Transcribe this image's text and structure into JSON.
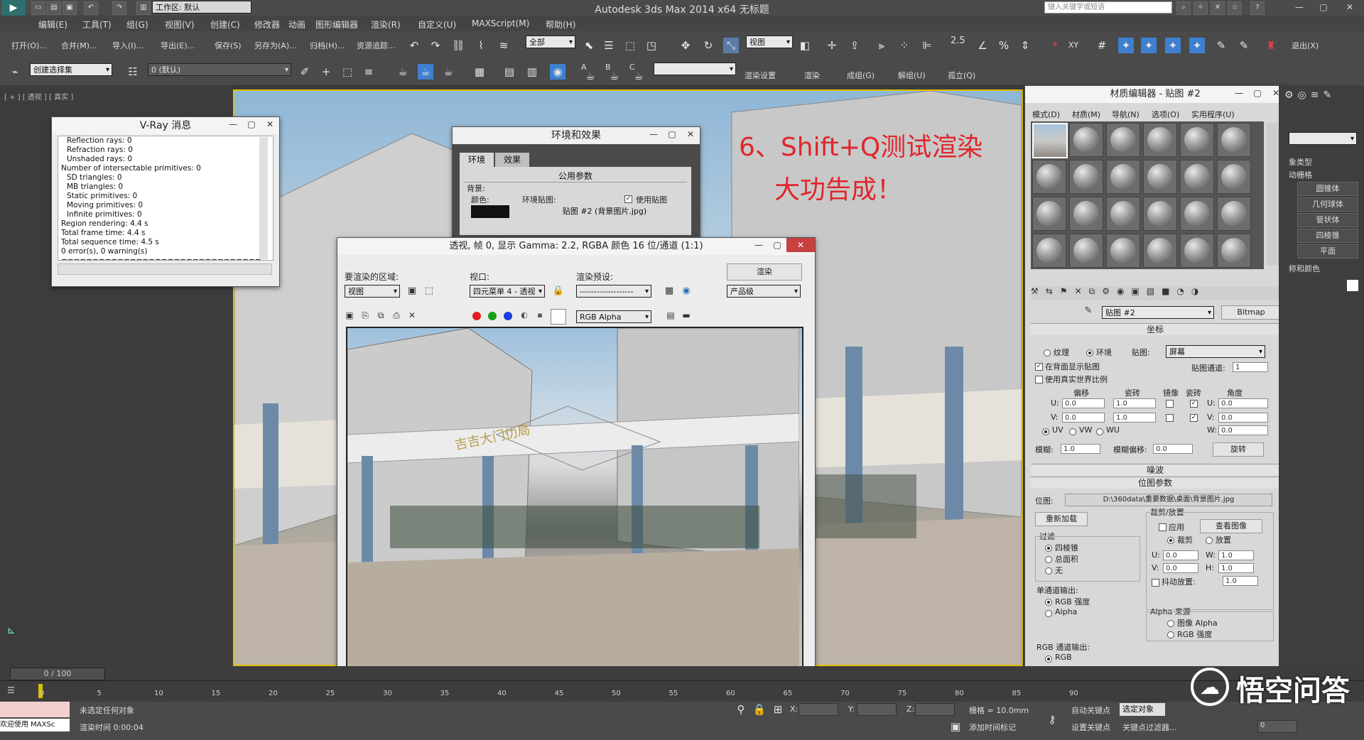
{
  "app": {
    "title": "Autodesk 3ds Max  2014 x64      无标题",
    "workspace": "工作区: 默认",
    "search_placeholder": "键入关键字或短语",
    "min": "—",
    "max": "▢",
    "close": "✕"
  },
  "menu": [
    "编辑(E)",
    "工具(T)",
    "组(G)",
    "视图(V)",
    "创建(C)",
    "修改器",
    "动画",
    "图形编辑器",
    "渲染(R)",
    "自定义(U)",
    "MAXScript(M)",
    "帮助(H)"
  ],
  "toolbar1": {
    "items": [
      "打开(O)...",
      "合并(M)...",
      "导入(I)...",
      "导出(E)...",
      "保存(S)",
      "另存为(A)...",
      "归档(H)...",
      "资源追踪..."
    ],
    "select_filter": "全部",
    "ref_coord": "视图",
    "snap_label": "2.5",
    "exit": "退出(X)"
  },
  "toolbar2": {
    "selection_set": "创建选择集",
    "layer": "0 (默认)",
    "render_setup": "渲染设置",
    "render": "渲染",
    "b1": "成组(G)",
    "b2": "解组(U)",
    "b3": "孤立(Q)",
    "letters": [
      "A",
      "B",
      "C"
    ]
  },
  "viewport": {
    "label": "[ + ] [ 透视 ] [ 真实 ]",
    "annotation1": "6、Shift+Q测试渲染",
    "annotation2": "大功告成！",
    "sign_text": "吉吉大门仂局",
    "colors": {
      "annotation": "#e0262b",
      "border": "#e0c200"
    }
  },
  "vray": {
    "title": "V-Ray 消息",
    "lines": [
      "Reflection rays: 0",
      "Refraction rays: 0",
      "Unshaded rays: 0",
      "Number of intersectable primitives: 0",
      "SD triangles: 0",
      "MB triangles: 0",
      "Static primitives: 0",
      "Moving primitives: 0",
      "Infinite primitives: 0",
      "Region rendering: 4.4 s",
      "Total frame time: 4.4 s",
      "Total sequence time: 4.5 s",
      "0 error(s), 0 warning(s)",
      "================================"
    ]
  },
  "env": {
    "title": "环境和效果",
    "tab1": "环境",
    "tab2": "效果",
    "section": "公用参数",
    "bg_label": "背景:",
    "color_label": "颜色:",
    "map_label": "环境贴图:",
    "use_map": "使用贴图",
    "map_name": "贴图 #2 (背景图片.jpg)"
  },
  "render_frame": {
    "title": "透视, 帧 0, 显示 Gamma: 2.2, RGBA 颜色 16 位/通道 (1:1)",
    "area_label": "要渲染的区域:",
    "area_value": "视图",
    "viewport_label": "视口:",
    "viewport_value": "四元菜单 4 - 透视",
    "preset_label": "渲染预设:",
    "preset_value": "-------------------",
    "render_btn": "渲染",
    "quality": "产品级",
    "channel": "RGB Alpha",
    "sign_text": "吉吉大门仂局"
  },
  "mat": {
    "title": "材质编辑器 - 贴图 #2",
    "menus": [
      "模式(D)",
      "材质(M)",
      "导航(N)",
      "选项(O)",
      "实用程序(U)"
    ],
    "map_name": "贴图 #2",
    "map_type": "Bitmap",
    "coord_section": "坐标",
    "texture": "纹理",
    "environ": "环境",
    "map_label": "贴图:",
    "map_value": "屏幕",
    "show_back": "在背面显示贴图",
    "real_world": "使用真实世界比例",
    "channel_label": "贴图通道:",
    "channel_value": "1",
    "col_offset": "偏移",
    "col_tiling": "瓷砖",
    "col_mirror": "镜像",
    "col_tile": "瓷砖",
    "col_angle": "角度",
    "u": "U:",
    "v": "V:",
    "w": "W:",
    "u_offset": "0.0",
    "v_offset": "0.0",
    "u_tiling": "1.0",
    "v_tiling": "1.0",
    "u_angle": "0.0",
    "v_angle": "0.0",
    "w_angle": "0.0",
    "uv": "UV",
    "vw": "VW",
    "wu": "WU",
    "blur_label": "模糊:",
    "blur_value": "1.0",
    "blur_offset_label": "模糊偏移:",
    "blur_offset_value": "0.0",
    "rotate": "旋转",
    "noise_section": "噪波",
    "bitmap_section": "位图参数",
    "bitmap_label": "位图:",
    "bitmap_path": "D:\\360data\\重要数据\\桌面\\背景图片.jpg",
    "reload": "重新加载",
    "crop_section": "裁剪/放置",
    "apply": "应用",
    "view_image": "查看图像",
    "crop": "裁剪",
    "place": "放置",
    "filter_section": "过滤",
    "f1": "四棱锥",
    "f2": "总面积",
    "f3": "无",
    "cu": "U:",
    "cv": "V:",
    "cw": "W:",
    "ch": "H:",
    "cu_val": "0.0",
    "cv_val": "0.0",
    "cw_val": "1.0",
    "ch_val": "1.0",
    "jitter": "抖动放置:",
    "jitter_val": "1.0",
    "mono_section": "单通道输出:",
    "mono1": "RGB 强度",
    "mono2": "Alpha",
    "alpha_section": "Alpha 来源",
    "alpha1": "图像 Alpha",
    "alpha2": "RGB 强度",
    "rgb_section": "RGB 通道输出:",
    "rgb1": "RGB"
  },
  "cmdpanel": [
    "象类型",
    "动栅格",
    "圆锥体",
    "几何球体",
    "管状体",
    "四棱锥",
    "平面",
    "称和颜色"
  ],
  "timeline": {
    "frame": "0 / 100",
    "ticks": [
      "0",
      "5",
      "10",
      "15",
      "20",
      "25",
      "30",
      "35",
      "40",
      "45",
      "50",
      "55",
      "60",
      "65",
      "70",
      "75",
      "80",
      "85",
      "90"
    ]
  },
  "status": {
    "welcome": "欢迎使用 MAXSc",
    "no_select": "未选定任何对象",
    "render_time": "渲染时间 0:00:04",
    "x": "X:",
    "y": "Y:",
    "z": "Z:",
    "grid": "栅格 = 10.0mm",
    "auto_key": "自动关键点",
    "set_key": "设置关键点",
    "selected": "选定对象",
    "key_filter": "关键点过滤器...",
    "add_tag": "添加时间标记",
    "frame_field": "0"
  },
  "watermark": "悟空问答"
}
